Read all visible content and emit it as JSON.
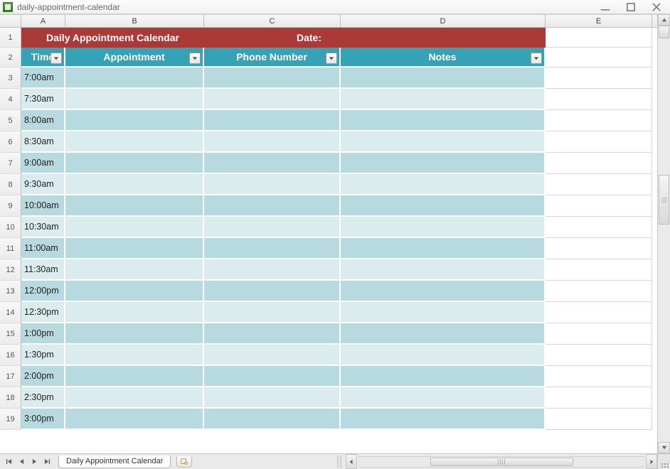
{
  "window": {
    "title": "daily-appointment-calendar"
  },
  "columns": {
    "A": "A",
    "B": "B",
    "C": "C",
    "D": "D",
    "E": "E"
  },
  "row_numbers": [
    "1",
    "2",
    "3",
    "4",
    "5",
    "6",
    "7",
    "8",
    "9",
    "10",
    "11",
    "12",
    "13",
    "14",
    "15",
    "16",
    "17",
    "18",
    "19"
  ],
  "title_band": {
    "title": "Daily Appointment Calendar",
    "date_label": "Date:"
  },
  "headers": {
    "time": "Time",
    "appointment": "Appointment",
    "phone": "Phone Number",
    "notes": "Notes"
  },
  "times": [
    "7:00am",
    "7:30am",
    "8:00am",
    "8:30am",
    "9:00am",
    "9:30am",
    "10:00am",
    "10:30am",
    "11:00am",
    "11:30am",
    "12:00pm",
    "12:30pm",
    "1:00pm",
    "1:30pm",
    "2:00pm",
    "2:30pm",
    "3:00pm"
  ],
  "sheet_tab": "Daily Appointment Calendar",
  "colors": {
    "title_bg": "#a93a37",
    "header_bg": "#35a2b6",
    "row_even": "#b6dae0",
    "row_odd": "#dbecef"
  }
}
